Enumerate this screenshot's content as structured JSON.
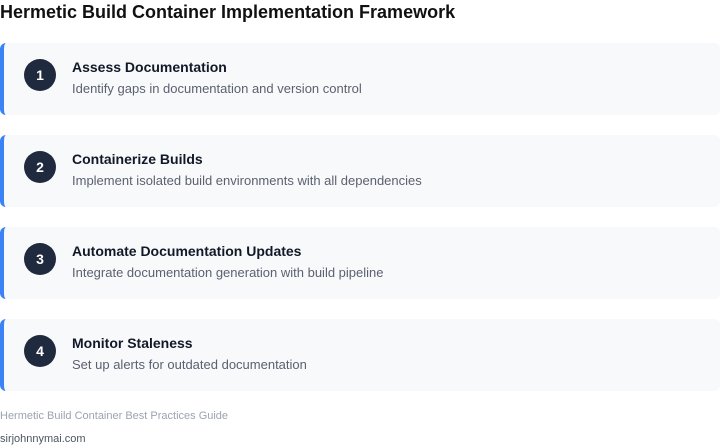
{
  "title": "Hermetic Build Container Implementation Framework",
  "steps": [
    {
      "number": "1",
      "title": "Assess Documentation",
      "description": "Identify gaps in documentation and version control"
    },
    {
      "number": "2",
      "title": "Containerize Builds",
      "description": "Implement isolated build environments with all dependencies"
    },
    {
      "number": "3",
      "title": "Automate Documentation Updates",
      "description": "Integrate documentation generation with build pipeline"
    },
    {
      "number": "4",
      "title": "Monitor Staleness",
      "description": "Set up alerts for outdated documentation"
    }
  ],
  "footer": {
    "note": "Hermetic Build Container Best Practices Guide",
    "site": "sirjohnnymai.com"
  },
  "colors": {
    "accent": "#3b82f6",
    "badge": "#1f2a3e",
    "card_background": "#f8f9fb"
  }
}
